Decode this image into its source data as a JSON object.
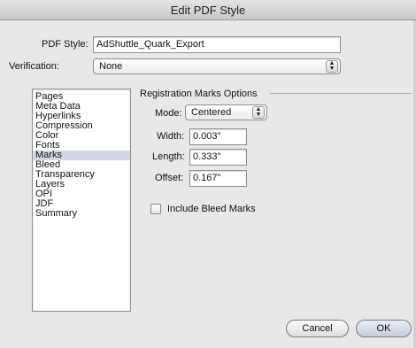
{
  "window": {
    "title": "Edit PDF Style"
  },
  "pdf_style": {
    "label": "PDF Style:",
    "value": "AdShuttle_Quark_Export"
  },
  "verification": {
    "label": "Verification:",
    "value": "None"
  },
  "sidebar": {
    "items": [
      {
        "label": "Pages"
      },
      {
        "label": "Meta Data"
      },
      {
        "label": "Hyperlinks"
      },
      {
        "label": "Compression"
      },
      {
        "label": "Color"
      },
      {
        "label": "Fonts"
      },
      {
        "label": "Marks",
        "selected": true
      },
      {
        "label": "Bleed"
      },
      {
        "label": "Transparency"
      },
      {
        "label": "Layers"
      },
      {
        "label": "OPI"
      },
      {
        "label": "JDF"
      },
      {
        "label": "Summary"
      }
    ]
  },
  "registration": {
    "heading": "Registration Marks Options",
    "mode": {
      "label": "Mode:",
      "value": "Centered"
    },
    "width": {
      "label": "Width:",
      "value": "0.003\""
    },
    "length": {
      "label": "Length:",
      "value": "0.333\""
    },
    "offset": {
      "label": "Offset:",
      "value": "0.167\""
    },
    "include_bleed": {
      "label": "Include Bleed Marks",
      "checked": false
    }
  },
  "buttons": {
    "cancel": "Cancel",
    "ok": "OK"
  }
}
